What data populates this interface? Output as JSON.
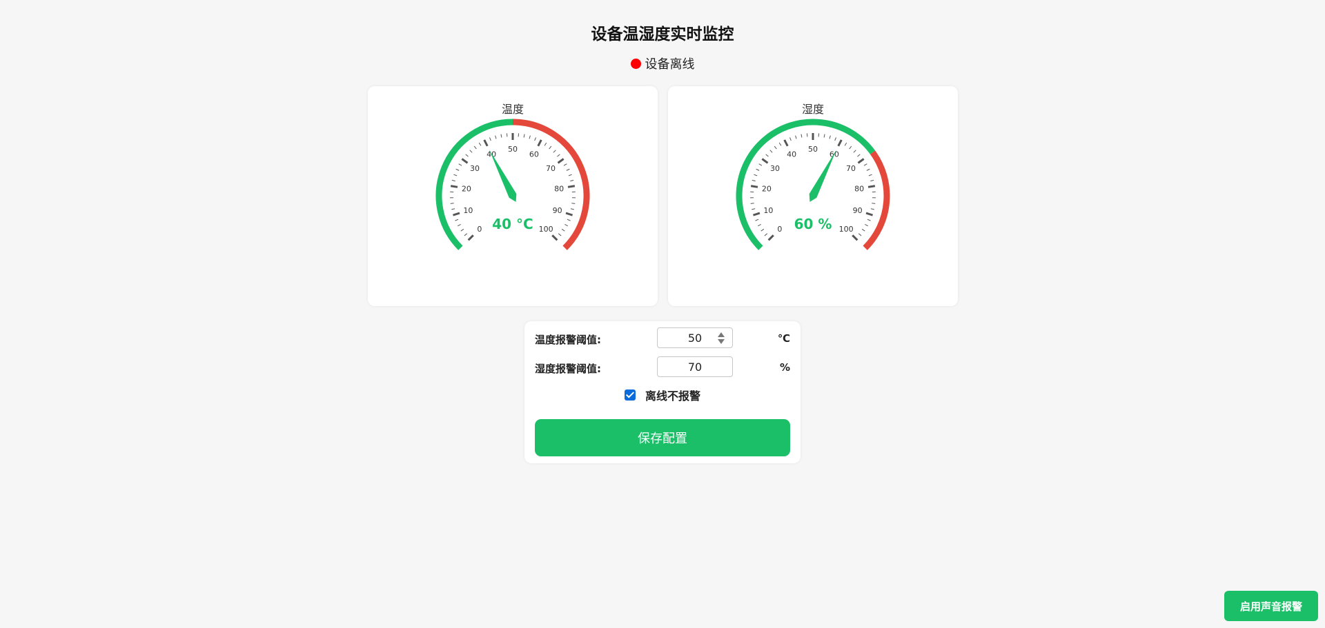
{
  "header": {
    "title": "设备温湿度实时监控",
    "status_text": "设备离线",
    "status_color": "#ff0000"
  },
  "gauges": {
    "temperature": {
      "title": "温度",
      "value": 40,
      "unit": "°C",
      "display": "40 °C",
      "min": 0,
      "max": 100,
      "threshold": 50,
      "tick_labels": [
        "0",
        "10",
        "20",
        "30",
        "40",
        "50",
        "60",
        "70",
        "80",
        "90",
        "100"
      ]
    },
    "humidity": {
      "title": "湿度",
      "value": 60,
      "unit": "%",
      "display": "60 %",
      "min": 0,
      "max": 100,
      "threshold": 70,
      "tick_labels": [
        "0",
        "10",
        "20",
        "30",
        "40",
        "50",
        "60",
        "70",
        "80",
        "90",
        "100"
      ]
    },
    "colors": {
      "normal": "#1bbf68",
      "alarm": "#e4483a",
      "ticks": "#555555",
      "labels": "#333333"
    }
  },
  "config": {
    "temp_threshold_label": "温度报警阈值:",
    "temp_threshold_value": "50",
    "temp_unit": "℃",
    "hum_threshold_label": "湿度报警阈值:",
    "hum_threshold_value": "70",
    "hum_unit": "%",
    "offline_no_alarm_label": "离线不报警",
    "offline_no_alarm_checked": true,
    "save_label": "保存配置"
  },
  "sound_alarm_label": "启用声音报警",
  "accent_color": "#1bbf68"
}
